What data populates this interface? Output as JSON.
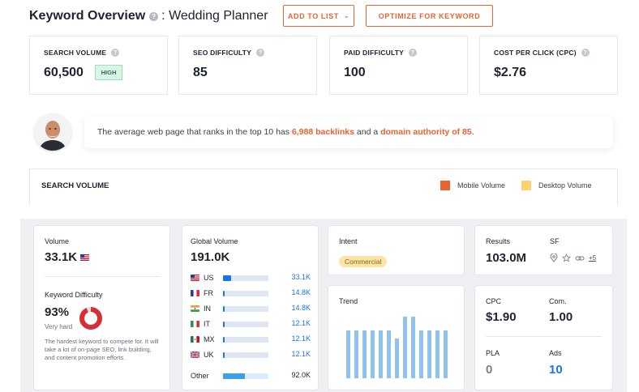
{
  "header": {
    "title": "Keyword Overview",
    "keyword": ": Wedding Planner",
    "add_to_list": "ADD TO LIST",
    "optimize": "OPTIMIZE FOR KEYWORD"
  },
  "metrics": [
    {
      "label": "SEARCH VOLUME",
      "value": "60,500",
      "badge": "HIGH"
    },
    {
      "label": "SEO DIFFICULTY",
      "value": "85"
    },
    {
      "label": "PAID DIFFICULTY",
      "value": "100"
    },
    {
      "label": "COST PER CLICK (CPC)",
      "value": "$2.76"
    }
  ],
  "banner": {
    "pre": "The average web page that ranks in the top 10 has ",
    "backlinks": "6,988 backlinks",
    "mid": " and a ",
    "authority": "domain authority of 85",
    "post": "."
  },
  "search_volume": {
    "title": "SEARCH VOLUME",
    "legend_mobile": "Mobile Volume",
    "legend_desktop": "Desktop Volume",
    "mobile_color": "#e9622f",
    "desktop_color": "#fdd26f"
  },
  "volume_card": {
    "volume_label": "Volume",
    "volume_value": "33.1K",
    "kd_label": "Keyword Difficulty",
    "kd_value": "93%",
    "kd_level": "Very hard",
    "kd_fraction": 0.93,
    "description": "The hardest keyword to compete for. It will take a lot of on-page SEO, link building, and content promotion efforts."
  },
  "global_volume": {
    "label": "Global Volume",
    "value": "191.0K",
    "countries": [
      {
        "code": "US",
        "value": "33.1K",
        "share": 0.17
      },
      {
        "code": "FR",
        "value": "14.8K",
        "share": 0.04
      },
      {
        "code": "IN",
        "value": "14.8K",
        "share": 0.04
      },
      {
        "code": "IT",
        "value": "12.1K",
        "share": 0.03
      },
      {
        "code": "MX",
        "value": "12.1K",
        "share": 0.03
      },
      {
        "code": "UK",
        "value": "12.1K",
        "share": 0.03
      }
    ],
    "other_label": "Other",
    "other_value": "92.0K",
    "other_share": 0.48
  },
  "intent": {
    "label": "Intent",
    "value": "Commercial"
  },
  "trend": {
    "label": "Trend",
    "values": [
      0.77,
      0.77,
      0.77,
      0.77,
      0.77,
      0.77,
      0.64,
      1.0,
      1.0,
      0.77,
      0.77,
      0.77,
      0.77
    ]
  },
  "results": {
    "label": "Results",
    "value": "103.0M",
    "sf_label": "SF",
    "sf_more": "+5"
  },
  "cpc": {
    "label": "CPC",
    "value": "$1.90",
    "com_label": "Com.",
    "com_value": "1.00"
  },
  "pla": {
    "label": "PLA",
    "value": "0",
    "ads_label": "Ads",
    "ads_value": "10"
  }
}
